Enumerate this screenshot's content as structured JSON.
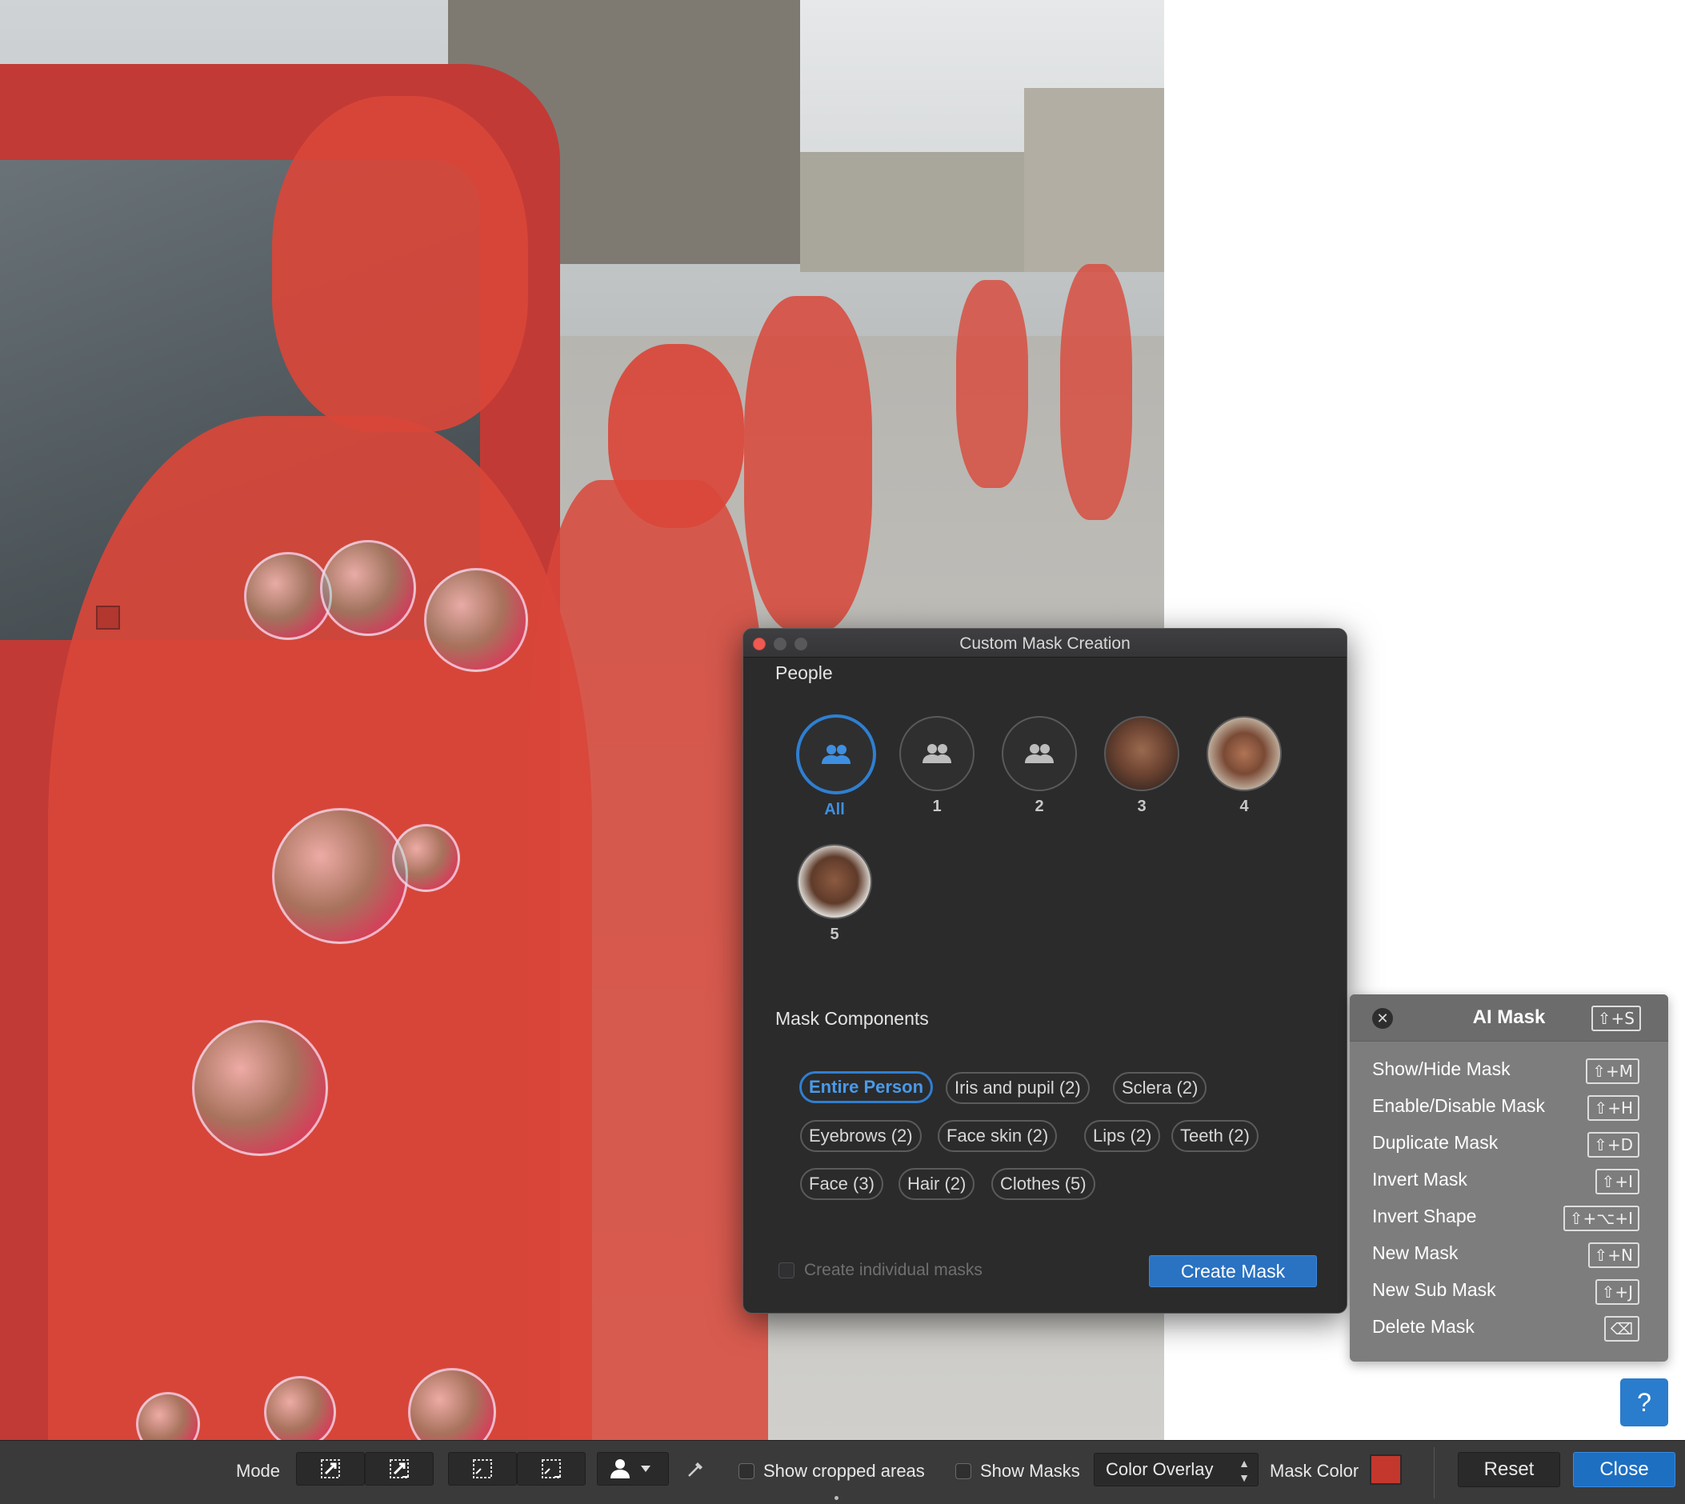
{
  "dialog": {
    "title": "Custom Mask Creation",
    "people_label": "People",
    "people": [
      {
        "label": "All",
        "selected": true,
        "icon": "people-icon"
      },
      {
        "label": "1",
        "selected": false,
        "icon": "people-icon"
      },
      {
        "label": "2",
        "selected": false,
        "icon": "people-icon"
      },
      {
        "label": "3",
        "selected": false,
        "icon": "face-thumbnail"
      },
      {
        "label": "4",
        "selected": false,
        "icon": "face-thumbnail"
      },
      {
        "label": "5",
        "selected": false,
        "icon": "face-thumbnail"
      }
    ],
    "components_label": "Mask Components",
    "components": [
      {
        "label": "Entire Person",
        "selected": true
      },
      {
        "label": "Iris and pupil (2)",
        "selected": false
      },
      {
        "label": "Sclera (2)",
        "selected": false
      },
      {
        "label": "Eyebrows (2)",
        "selected": false
      },
      {
        "label": "Face skin (2)",
        "selected": false
      },
      {
        "label": "Lips (2)",
        "selected": false
      },
      {
        "label": "Teeth (2)",
        "selected": false
      },
      {
        "label": "Face (3)",
        "selected": false
      },
      {
        "label": "Hair (2)",
        "selected": false
      },
      {
        "label": "Clothes (5)",
        "selected": false
      }
    ],
    "individual_masks_label": "Create individual masks",
    "individual_masks_checked": false,
    "create_button": "Create Mask"
  },
  "ai_mask": {
    "title": "AI Mask",
    "shortcut": "⇧+S",
    "items": [
      {
        "label": "Show/Hide Mask",
        "shortcut": "⇧+M"
      },
      {
        "label": "Enable/Disable Mask",
        "shortcut": "⇧+H"
      },
      {
        "label": "Duplicate Mask",
        "shortcut": "⇧+D"
      },
      {
        "label": "Invert Mask",
        "shortcut": "⇧+I"
      },
      {
        "label": "Invert Shape",
        "shortcut": "⇧+⌥+I"
      },
      {
        "label": "New Mask",
        "shortcut": "⇧+N"
      },
      {
        "label": "New Sub Mask",
        "shortcut": "⇧+J"
      },
      {
        "label": "Delete Mask",
        "shortcut": "⌫"
      }
    ]
  },
  "help": {
    "label": "?"
  },
  "toolbar": {
    "mode_label": "Mode",
    "show_cropped_label": "Show cropped areas",
    "show_cropped_checked": false,
    "show_masks_label": "Show Masks",
    "show_masks_checked": false,
    "overlay_value": "Color Overlay",
    "mask_color_label": "Mask Color",
    "mask_color": "#c4372d",
    "reset_label": "Reset",
    "close_label": "Close"
  }
}
